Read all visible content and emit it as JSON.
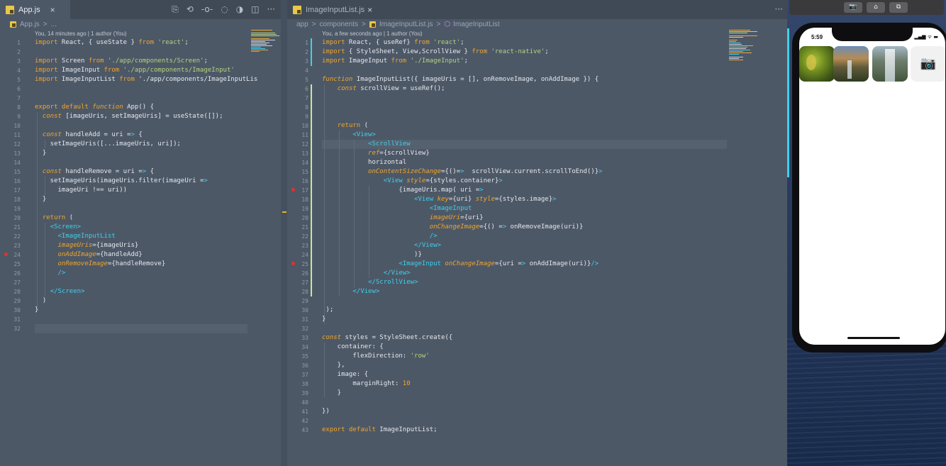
{
  "left_editor": {
    "tab": {
      "label": "App.js",
      "close": "×"
    },
    "toolbar_icons": [
      "⎘",
      "⟲",
      "-o-",
      "◌",
      "◑",
      "◫",
      "···"
    ],
    "breadcrumb": [
      "App.js",
      ">",
      "..."
    ],
    "blame": "You, 14 minutes ago | 1 author (You)",
    "lines": [
      {
        "n": "1",
        "t": "import React, { useState } from 'react';"
      },
      {
        "n": "2",
        "t": ""
      },
      {
        "n": "3",
        "t": "import Screen from './app/components/Screen';"
      },
      {
        "n": "4",
        "t": "import ImageInput from './app/components/ImageInput'"
      },
      {
        "n": "5",
        "t": "import ImageInputList from './app/components/ImageInputLis"
      },
      {
        "n": "6",
        "t": ""
      },
      {
        "n": "7",
        "t": ""
      },
      {
        "n": "8",
        "t": "export default function App() {"
      },
      {
        "n": "9",
        "t": "  const [imageUris, setImageUris] = useState([]);"
      },
      {
        "n": "10",
        "t": ""
      },
      {
        "n": "11",
        "t": "  const handleAdd = uri => {"
      },
      {
        "n": "12",
        "t": "    setImageUris([...imageUris, uri]);"
      },
      {
        "n": "13",
        "t": "  }"
      },
      {
        "n": "14",
        "t": ""
      },
      {
        "n": "15",
        "t": "  const handleRemove = uri => {"
      },
      {
        "n": "16",
        "t": "    setImageUris(imageUris.filter(imageUri =>"
      },
      {
        "n": "17",
        "t": "      imageUri !== uri))"
      },
      {
        "n": "18",
        "t": "  }"
      },
      {
        "n": "19",
        "t": ""
      },
      {
        "n": "20",
        "t": "  return ("
      },
      {
        "n": "21",
        "t": "    <Screen>"
      },
      {
        "n": "22",
        "t": "      <ImageInputList"
      },
      {
        "n": "23",
        "t": "      imageUris={imageUris}"
      },
      {
        "n": "24",
        "t": "      onAddImage={handleAdd}"
      },
      {
        "n": "25",
        "t": "      onRemoveImage={handleRemove}"
      },
      {
        "n": "26",
        "t": "      />"
      },
      {
        "n": "27",
        "t": ""
      },
      {
        "n": "28",
        "t": "    </Screen>"
      },
      {
        "n": "29",
        "t": "  )"
      },
      {
        "n": "30",
        "t": "}"
      },
      {
        "n": "31",
        "t": ""
      },
      {
        "n": "32",
        "t": ""
      }
    ]
  },
  "right_editor": {
    "tab": {
      "label": "ImageInputList.js",
      "close": "×"
    },
    "more": "···",
    "breadcrumb": [
      "app",
      ">",
      "components",
      ">",
      "ImageInputList.js",
      ">",
      "ImageInputList"
    ],
    "blame": "You, a few seconds ago | 1 author (You)",
    "lines": [
      {
        "n": "1",
        "t": "import React, { useRef} from 'react';"
      },
      {
        "n": "2",
        "t": "import { StyleSheet, View,ScrollView } from 'react-native';"
      },
      {
        "n": "3",
        "t": "import ImageInput from './ImageInput';"
      },
      {
        "n": "4",
        "t": ""
      },
      {
        "n": "5",
        "t": "function ImageInputList({ imageUris = [], onRemoveImage, onAddImage }) {"
      },
      {
        "n": "6",
        "t": "    const scrollView = useRef();"
      },
      {
        "n": "7",
        "t": ""
      },
      {
        "n": "8",
        "t": ""
      },
      {
        "n": "9",
        "t": ""
      },
      {
        "n": "10",
        "t": "    return ("
      },
      {
        "n": "11",
        "t": "        <View>"
      },
      {
        "n": "12",
        "t": "            <ScrollView"
      },
      {
        "n": "13",
        "t": "            ref={scrollView}"
      },
      {
        "n": "14",
        "t": "            horizontal"
      },
      {
        "n": "15",
        "t": "            onContentSizeChange={()=>  scrollView.current.scrollToEnd()}>"
      },
      {
        "n": "16",
        "t": "                <View style={styles.container}>"
      },
      {
        "n": "17",
        "t": "                    {imageUris.map( uri =>"
      },
      {
        "n": "18",
        "t": "                        <View key={uri} style={styles.image}>"
      },
      {
        "n": "19",
        "t": "                            <ImageInput"
      },
      {
        "n": "20",
        "t": "                            imageUri={uri}"
      },
      {
        "n": "21",
        "t": "                            onChangeImage={() => onRemoveImage(uri)}"
      },
      {
        "n": "22",
        "t": "                            />"
      },
      {
        "n": "23",
        "t": "                        </View>"
      },
      {
        "n": "24",
        "t": "                        )}"
      },
      {
        "n": "25",
        "t": "                    <ImageInput onChangeImage={uri => onAddImage(uri)}/>"
      },
      {
        "n": "26",
        "t": "                </View>"
      },
      {
        "n": "27",
        "t": "            </ScrollView>"
      },
      {
        "n": "28",
        "t": "        </View>"
      },
      {
        "n": "29",
        "t": ""
      },
      {
        "n": "30",
        "t": " );"
      },
      {
        "n": "31",
        "t": "}"
      },
      {
        "n": "32",
        "t": ""
      },
      {
        "n": "33",
        "t": "const styles = StyleSheet.create({"
      },
      {
        "n": "34",
        "t": "    container: {"
      },
      {
        "n": "35",
        "t": "        flexDirection: 'row'"
      },
      {
        "n": "36",
        "t": "    },"
      },
      {
        "n": "37",
        "t": "    image: {"
      },
      {
        "n": "38",
        "t": "        marginRight: 10"
      },
      {
        "n": "39",
        "t": "    }"
      },
      {
        "n": "40",
        "t": ""
      },
      {
        "n": "41",
        "t": "})"
      },
      {
        "n": "42",
        "t": ""
      },
      {
        "n": "43",
        "t": "export default ImageInputList;"
      }
    ]
  },
  "simulator": {
    "toolbar": [
      "📷",
      "⌂",
      "⧉"
    ],
    "status_time": "5:59",
    "status_icons": "▂▄▆ ᯤ ▬",
    "camera_icon": "📷"
  },
  "colors": {
    "editor_bg": "#4d5867",
    "keyword": "#f0a62b",
    "string": "#b7d37c",
    "tag": "#3fd0ea",
    "breakpoint": "#e1322d"
  }
}
